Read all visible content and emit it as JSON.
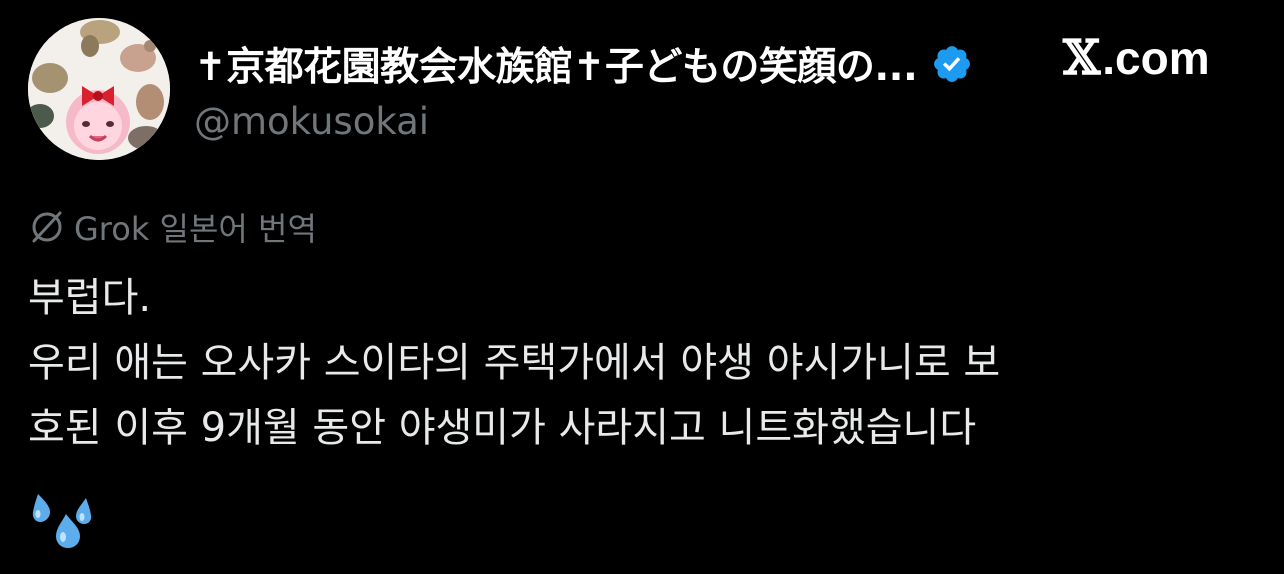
{
  "post": {
    "author": {
      "display_name": "✝京都花園教会水族館✝子どもの笑顔の...",
      "handle": "@mokusokai",
      "verified": true,
      "verified_color": "#1d9bf0"
    },
    "brand": {
      "x_glyph": "𝕏",
      "domain": ".com"
    },
    "translation": {
      "icon": "grok-icon",
      "label": "Grok 일본어 번역"
    },
    "text_lines": [
      "부럽다.",
      "우리 애는 오사카 스이타의 주택가에서 야생 야시가니로 보",
      "호된 이후 9개월 동안 야생미가 사라지고 니트화했습니다"
    ],
    "emoji": "sweat-droplets-emoji"
  },
  "colors": {
    "background": "#000000",
    "primary_text": "#e7e9ea",
    "secondary_text": "#71767b",
    "accent": "#1d9bf0"
  }
}
